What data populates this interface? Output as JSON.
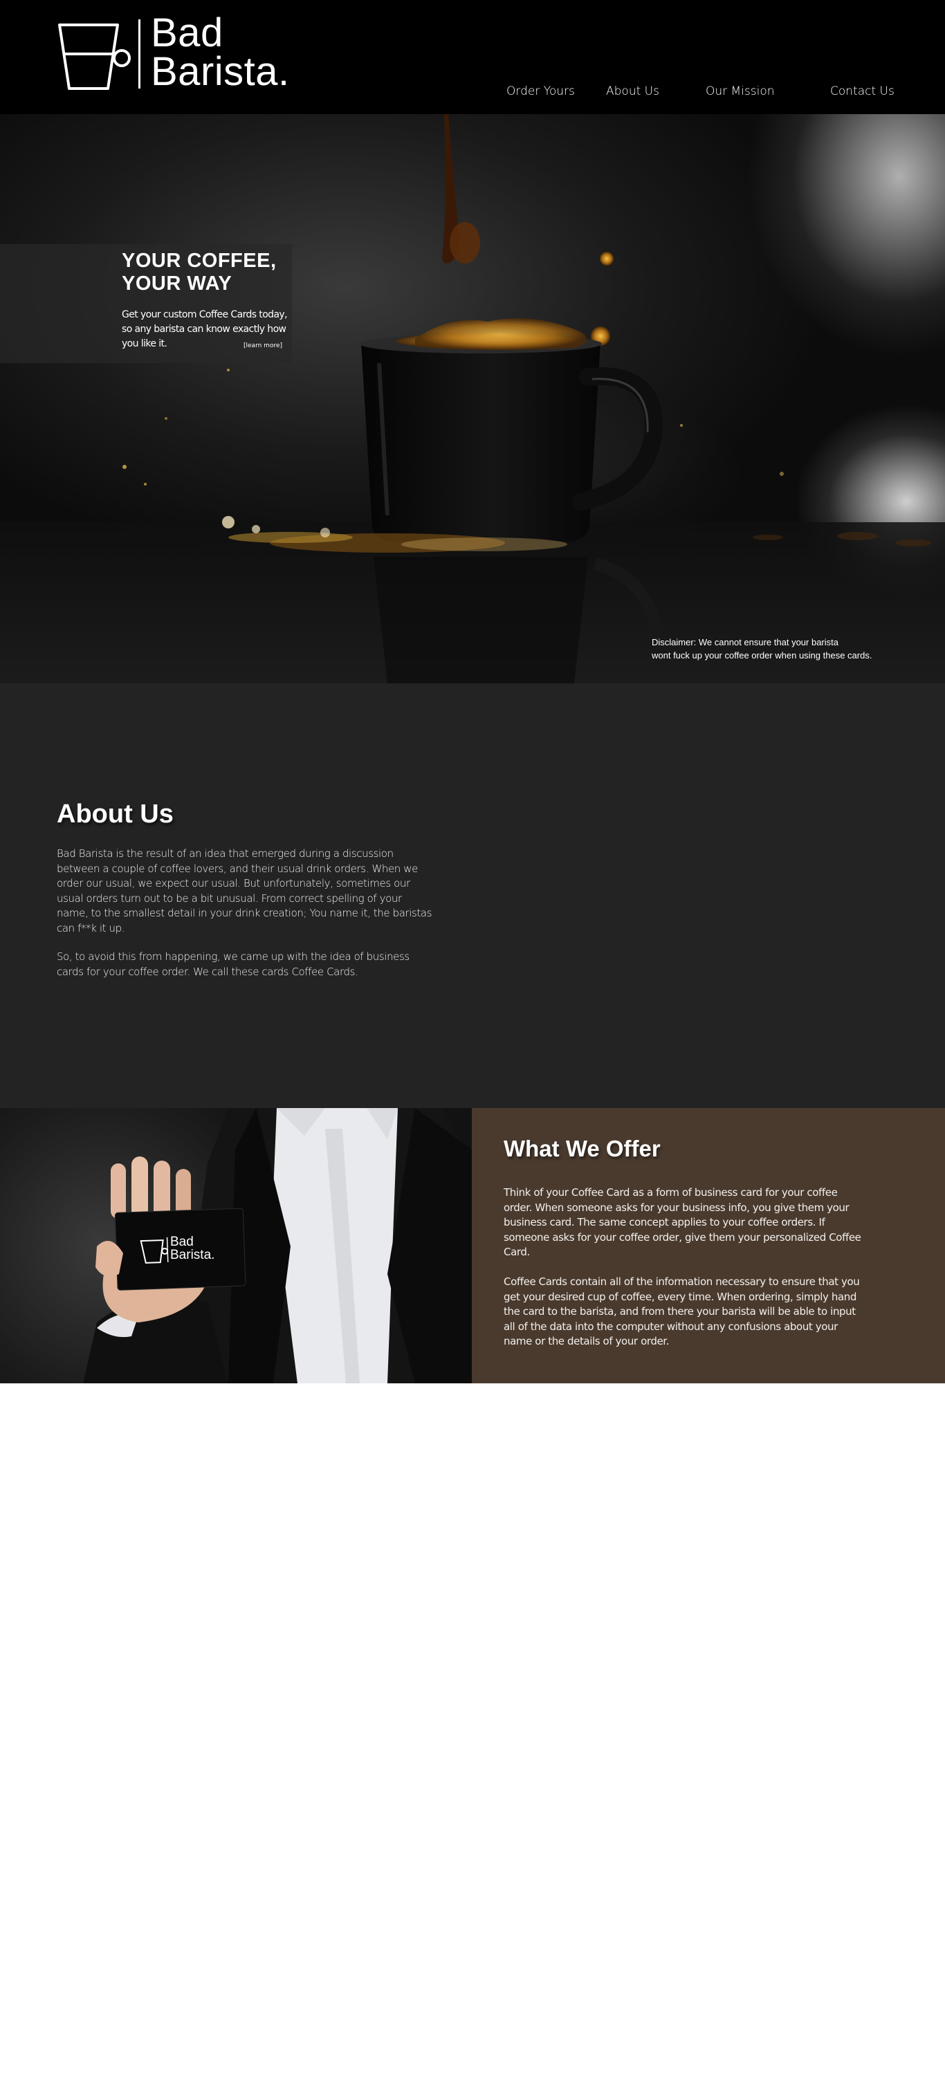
{
  "header": {
    "logo_line1": "Bad",
    "logo_line2": "Barista.",
    "nav": [
      {
        "label": "Order Yours"
      },
      {
        "label": "About Us"
      },
      {
        "label": "Our Mission"
      },
      {
        "label": "Contact Us"
      }
    ]
  },
  "hero": {
    "title_line1": "YOUR COFFEE,",
    "title_line2": "YOUR WAY",
    "text": "Get your custom Coffee Cards today, so any barista can know exactly how you like it.",
    "learn_more": "[learn more]",
    "disclaimer_line1": "Disclaimer: We cannot ensure that your barista",
    "disclaimer_line2": "wont fuck up your coffee order when using these cards."
  },
  "about": {
    "title": "About Us",
    "paragraph1": "Bad Barista is the result of an idea that emerged during a discussion between a couple of coffee lovers, and their usual drink orders. When we order our usual, we expect our usual. But unfortunately, sometimes our usual orders turn out to be a bit unusual. From correct spelling of your name, to the smallest detail in your drink creation; You name it, the baristas can f**k it up.",
    "paragraph2": "So, to avoid this from happening, we came up with the idea of business cards for your coffee order. We call these cards Coffee Cards."
  },
  "offer": {
    "card_line1": "Bad",
    "card_line2": "Barista.",
    "title": "What We Offer",
    "paragraph1": "Think of your Coffee Card as a form of business card for your coffee order. When someone asks for your business info, you give them your business card. The same concept applies to your coffee orders. If someone asks for your coffee order, give them your personalized Coffee Card.",
    "paragraph2": "Coffee Cards contain all of the information necessary to ensure that you get your desired cup of coffee, every time. When ordering, simply hand the card to the barista, and from there your barista will be able to input all of the data into the computer without any confusions about your name or the details of your order."
  },
  "colors": {
    "header_bg": "#000000",
    "about_bg": "#232323",
    "offer_panel_bg": "#4a3a2e"
  }
}
